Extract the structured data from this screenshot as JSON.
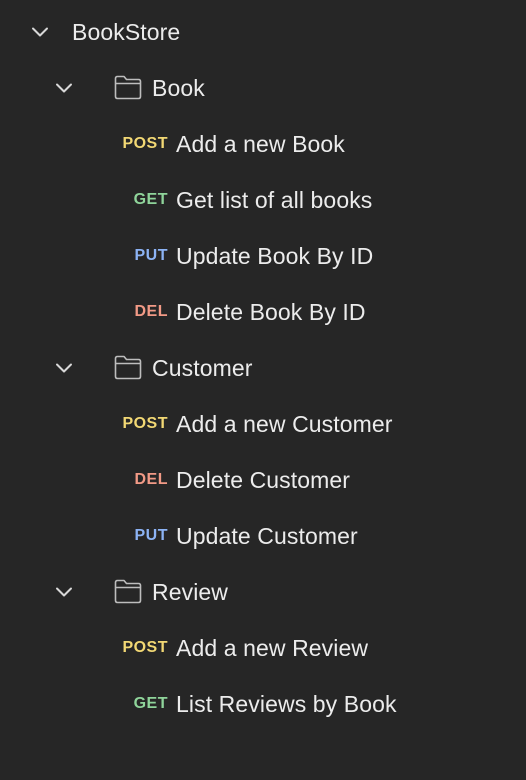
{
  "colors": {
    "background": "#262626",
    "text": "#ececec",
    "icon": "#bdbdbd",
    "method_post": "#f2d874",
    "method_get": "#8fd49a",
    "method_put": "#8cb3f5",
    "method_del": "#f29a86"
  },
  "collection": {
    "name": "BookStore",
    "expanded_icon": "chevron-down-icon"
  },
  "folders": [
    {
      "name": "Book",
      "icon": "folder-icon",
      "requests": [
        {
          "method": "POST",
          "name": "Add a new Book"
        },
        {
          "method": "GET",
          "name": "Get list of all books"
        },
        {
          "method": "PUT",
          "name": "Update Book By ID"
        },
        {
          "method": "DEL",
          "name": "Delete Book By ID"
        }
      ]
    },
    {
      "name": "Customer",
      "icon": "folder-icon",
      "requests": [
        {
          "method": "POST",
          "name": "Add a new Customer"
        },
        {
          "method": "DEL",
          "name": "Delete Customer"
        },
        {
          "method": "PUT",
          "name": "Update Customer"
        }
      ]
    },
    {
      "name": "Review",
      "icon": "folder-icon",
      "requests": [
        {
          "method": "POST",
          "name": "Add a new Review"
        },
        {
          "method": "GET",
          "name": "List Reviews by Book"
        }
      ]
    }
  ]
}
